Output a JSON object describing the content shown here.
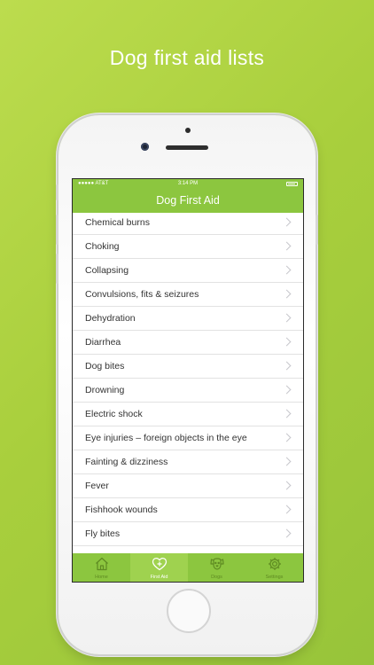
{
  "headline": "Dog first aid lists",
  "status_bar": {
    "carrier": "●●●●● AT&T",
    "time": "3:14 PM"
  },
  "nav": {
    "title": "Dog First Aid"
  },
  "items": [
    {
      "label": "Chemical burns"
    },
    {
      "label": "Choking"
    },
    {
      "label": "Collapsing"
    },
    {
      "label": "Convulsions, fits & seizures"
    },
    {
      "label": "Dehydration"
    },
    {
      "label": "Diarrhea"
    },
    {
      "label": "Dog bites"
    },
    {
      "label": "Drowning"
    },
    {
      "label": "Electric shock"
    },
    {
      "label": "Eye injuries – foreign objects in the eye"
    },
    {
      "label": "Fainting & dizziness"
    },
    {
      "label": "Fever"
    },
    {
      "label": "Fishhook wounds"
    },
    {
      "label": "Fly bites"
    }
  ],
  "tabs": [
    {
      "label": "Home",
      "icon": "house-icon"
    },
    {
      "label": "First Aid",
      "icon": "heart-plus-icon",
      "active": true
    },
    {
      "label": "Dogs",
      "icon": "dog-face-icon"
    },
    {
      "label": "Settings",
      "icon": "gear-icon"
    }
  ],
  "colors": {
    "accent": "#8cc63f",
    "background": "#a9cf3d",
    "text": "#333333",
    "separator": "#e2e2e2"
  }
}
